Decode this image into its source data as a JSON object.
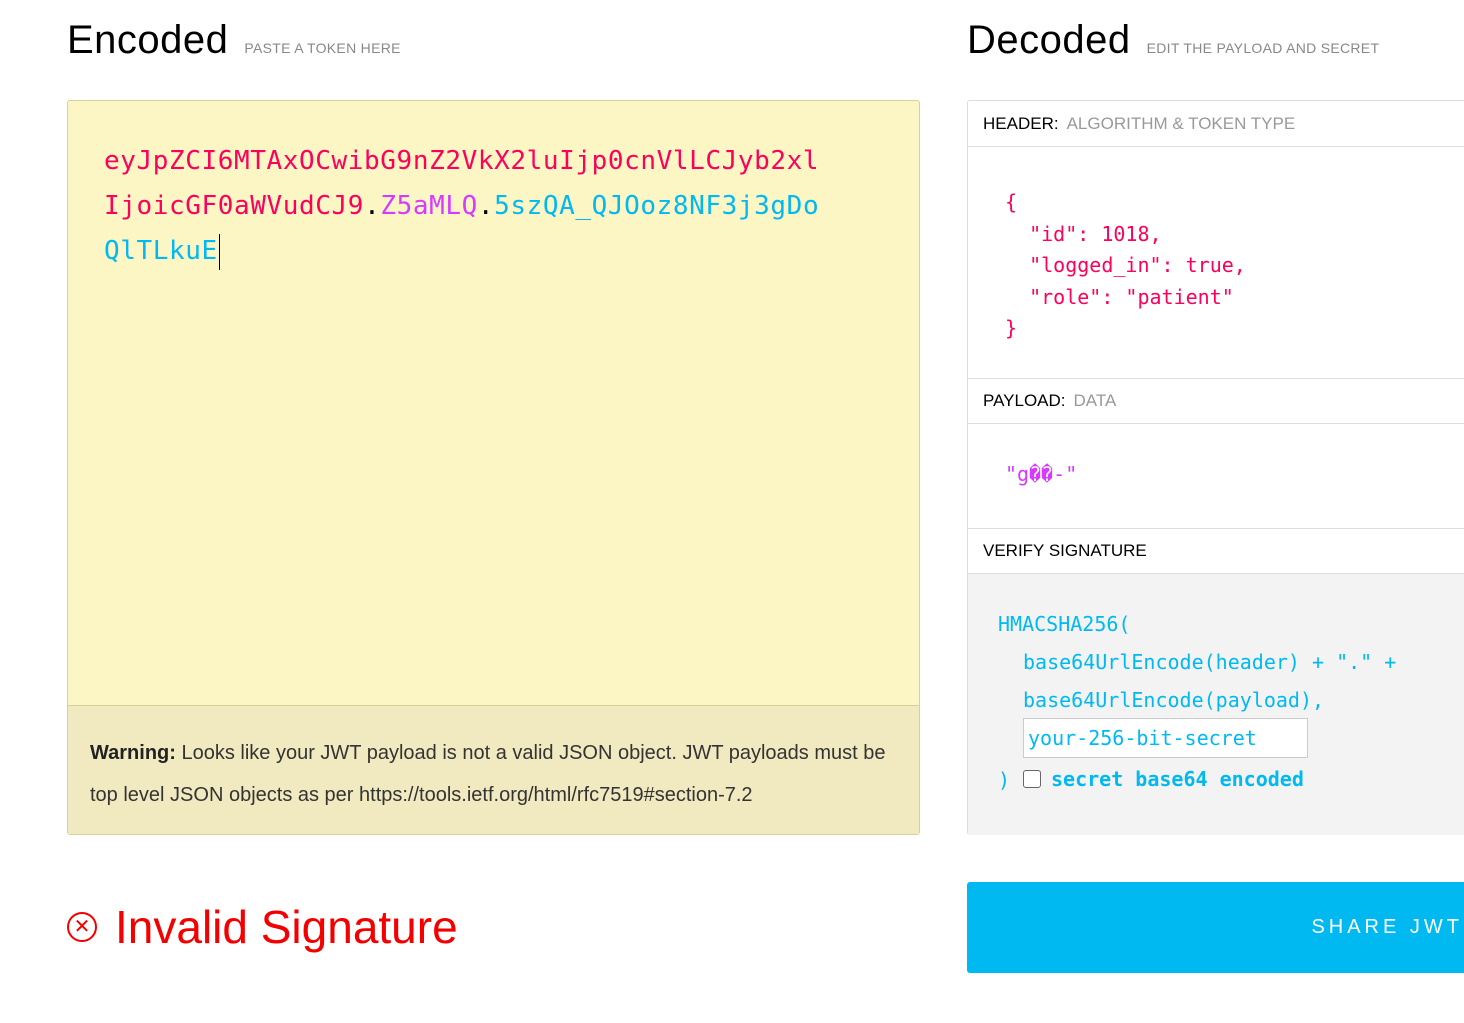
{
  "encoded": {
    "title": "Encoded",
    "subtitle": "PASTE A TOKEN HERE",
    "token": {
      "header": "eyJpZCI6MTAxOCwibG9nZ2VkX2luIjp0cnVlLCJyb2xlIjoicGF0aWVudCJ9",
      "dot1": ".",
      "payload": "Z5aMLQ",
      "dot2": ".",
      "signature": "5szQA_QJOoz8NF3j3gDoQlTLkuE"
    },
    "warning": {
      "label": "Warning:",
      "text": " Looks like your JWT payload is not a valid JSON object. JWT payloads must be top level JSON objects as per https://tools.ietf.org/html/rfc7519#section-7.2"
    }
  },
  "status": {
    "icon": "close-circle-icon",
    "text": "Invalid Signature",
    "color": "#f30000"
  },
  "decoded": {
    "title": "Decoded",
    "subtitle": "EDIT THE PAYLOAD AND SECRET",
    "header_section": {
      "label": "HEADER:",
      "desc": "ALGORITHM & TOKEN TYPE",
      "json": "{\n  \"id\": 1018,\n  \"logged_in\": true,\n  \"role\": \"patient\"\n}"
    },
    "payload_section": {
      "label": "PAYLOAD:",
      "desc": "DATA",
      "value": "\"g��-\""
    },
    "verify_section": {
      "label": "VERIFY SIGNATURE",
      "line1": "HMACSHA256(",
      "line2": "base64UrlEncode(header) + \".\" +",
      "line3": "base64UrlEncode(payload),",
      "secret_placeholder": "your-256-bit-secret",
      "close": ")",
      "checkbox_label": "secret base64 encoded"
    }
  },
  "share_button": "SHARE JWT",
  "colors": {
    "header": "#fb015b",
    "payload": "#d63aff",
    "signature": "#00b9f1",
    "encoded_bg": "#fcf6c5"
  }
}
